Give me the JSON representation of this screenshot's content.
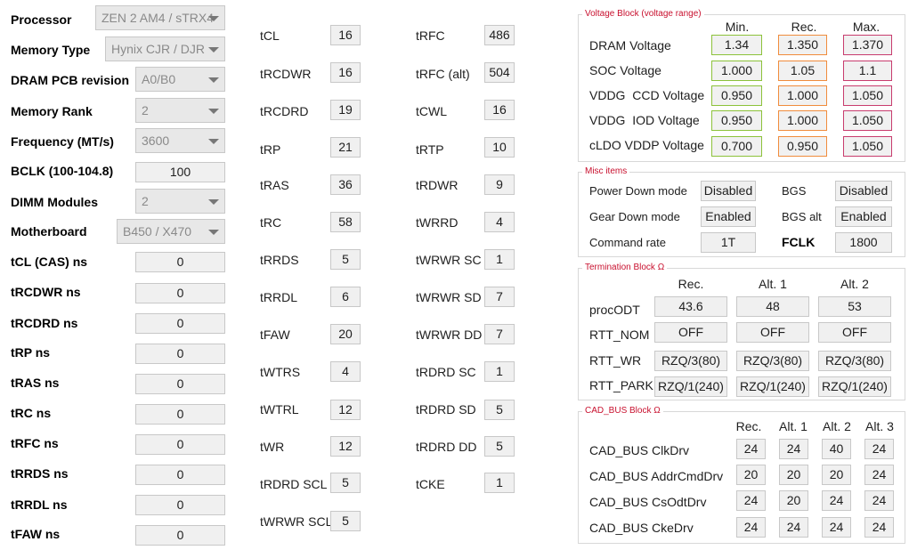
{
  "left": {
    "rows": [
      {
        "label": "Processor",
        "value": "ZEN 2 AM4 / sTRX4",
        "kind": "combo"
      },
      {
        "label": "Memory Type",
        "value": "Hynix CJR / DJR",
        "kind": "combo"
      },
      {
        "label": "DRAM PCB revision",
        "value": "A0/B0",
        "kind": "combo"
      },
      {
        "label": "Memory Rank",
        "value": "2",
        "kind": "combo"
      },
      {
        "label": "Frequency (MT/s)",
        "value": "3600",
        "kind": "combo"
      },
      {
        "label": "BCLK (100-104.8)",
        "value": "100",
        "kind": "field"
      },
      {
        "label": "DIMM Modules",
        "value": "2",
        "kind": "combo"
      },
      {
        "label": "Motherboard",
        "value": "B450 / X470",
        "kind": "combo"
      },
      {
        "label": "tCL (CAS) ns",
        "value": "0",
        "kind": "field"
      },
      {
        "label": "tRCDWR ns",
        "value": "0",
        "kind": "field"
      },
      {
        "label": "tRCDRD ns",
        "value": "0",
        "kind": "field"
      },
      {
        "label": "tRP ns",
        "value": "0",
        "kind": "field"
      },
      {
        "label": "tRAS ns",
        "value": "0",
        "kind": "field"
      },
      {
        "label": "tRC ns",
        "value": "0",
        "kind": "field"
      },
      {
        "label": "tRFC ns",
        "value": "0",
        "kind": "field"
      },
      {
        "label": "tRRDS ns",
        "value": "0",
        "kind": "field"
      },
      {
        "label": "tRRDL ns",
        "value": "0",
        "kind": "field"
      },
      {
        "label": "tFAW ns",
        "value": "0",
        "kind": "field"
      }
    ]
  },
  "mid1": [
    {
      "label": "tCL",
      "value": "16"
    },
    {
      "label": "tRCDWR",
      "value": "16"
    },
    {
      "label": "tRCDRD",
      "value": "19"
    },
    {
      "label": "tRP",
      "value": "21"
    },
    {
      "label": "tRAS",
      "value": "36"
    },
    {
      "label": "tRC",
      "value": "58"
    },
    {
      "label": "tRRDS",
      "value": "5"
    },
    {
      "label": "tRRDL",
      "value": "6"
    },
    {
      "label": "tFAW",
      "value": "20"
    },
    {
      "label": "tWTRS",
      "value": "4"
    },
    {
      "label": "tWTRL",
      "value": "12"
    },
    {
      "label": "tWR",
      "value": "12"
    },
    {
      "label": "tRDRD SCL",
      "value": "5"
    },
    {
      "label": "tWRWR SCL",
      "value": "5"
    }
  ],
  "mid2": [
    {
      "label": "tRFC",
      "value": "486"
    },
    {
      "label": "tRFC (alt)",
      "value": "504"
    },
    {
      "label": "tCWL",
      "value": "16"
    },
    {
      "label": "tRTP",
      "value": "10"
    },
    {
      "label": "tRDWR",
      "value": "9"
    },
    {
      "label": "tWRRD",
      "value": "4"
    },
    {
      "label": "tWRWR SC",
      "value": "1"
    },
    {
      "label": "tWRWR SD",
      "value": "7"
    },
    {
      "label": "tWRWR DD",
      "value": "7"
    },
    {
      "label": "tRDRD SC",
      "value": "1"
    },
    {
      "label": "tRDRD SD",
      "value": "5"
    },
    {
      "label": "tRDRD DD",
      "value": "5"
    },
    {
      "label": "tCKE",
      "value": "1"
    }
  ],
  "voltage": {
    "title": "Voltage Block (voltage range)",
    "headers": [
      "Min.",
      "Rec.",
      "Max."
    ],
    "rows": [
      {
        "label": "DRAM Voltage",
        "min": "1.34",
        "rec": "1.350",
        "max": "1.370"
      },
      {
        "label": "SOC Voltage",
        "min": "1.000",
        "rec": "1.05",
        "max": "1.1"
      },
      {
        "label": "VDDG  CCD Voltage",
        "min": "0.950",
        "rec": "1.000",
        "max": "1.050"
      },
      {
        "label": "VDDG  IOD Voltage",
        "min": "0.950",
        "rec": "1.000",
        "max": "1.050"
      },
      {
        "label": "cLDO VDDP Voltage",
        "min": "0.700",
        "rec": "0.950",
        "max": "1.050"
      }
    ]
  },
  "misc": {
    "title": "Misc items",
    "power_down_label": "Power Down mode",
    "power_down_value": "Disabled",
    "bgs_label": "BGS",
    "bgs_value": "Disabled",
    "gear_down_label": "Gear Down mode",
    "gear_down_value": "Enabled",
    "bgs_alt_label": "BGS alt",
    "bgs_alt_value": "Enabled",
    "command_rate_label": "Command rate",
    "command_rate_value": "1T",
    "fclk_label": "FCLK",
    "fclk_value": "1800"
  },
  "termination": {
    "title": "Termination Block Ω",
    "headers": [
      "Rec.",
      "Alt. 1",
      "Alt. 2"
    ],
    "rows": [
      {
        "label": "procODT",
        "values": [
          "43.6",
          "48",
          "53"
        ]
      },
      {
        "label": "RTT_NOM",
        "values": [
          "OFF",
          "OFF",
          "OFF"
        ]
      },
      {
        "label": "RTT_WR",
        "values": [
          "RZQ/3(80)",
          "RZQ/3(80)",
          "RZQ/3(80)"
        ]
      },
      {
        "label": "RTT_PARK",
        "values": [
          "RZQ/1(240)",
          "RZQ/1(240)",
          "RZQ/1(240)"
        ]
      }
    ]
  },
  "cadbus": {
    "title": "CAD_BUS Block Ω",
    "headers": [
      "Rec.",
      "Alt. 1",
      "Alt. 2",
      "Alt. 3"
    ],
    "rows": [
      {
        "label": "CAD_BUS ClkDrv",
        "values": [
          "24",
          "24",
          "40",
          "24"
        ]
      },
      {
        "label": "CAD_BUS AddrCmdDrv",
        "values": [
          "20",
          "20",
          "20",
          "24"
        ]
      },
      {
        "label": "CAD_BUS CsOdtDrv",
        "values": [
          "24",
          "20",
          "24",
          "24"
        ]
      },
      {
        "label": "CAD_BUS CkeDrv",
        "values": [
          "24",
          "24",
          "24",
          "24"
        ]
      }
    ]
  }
}
